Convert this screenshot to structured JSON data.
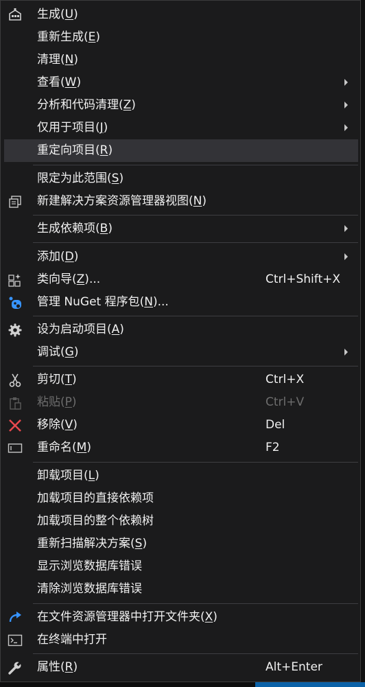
{
  "menu": {
    "build": {
      "label": "生成",
      "key": "U"
    },
    "rebuild": {
      "label": "重新生成",
      "key": "E"
    },
    "clean": {
      "label": "清理",
      "key": "N"
    },
    "view": {
      "label": "查看",
      "key": "W"
    },
    "analyze": {
      "label": "分析和代码清理",
      "key": "Z"
    },
    "project_only": {
      "label": "仅用于项目",
      "key": "J"
    },
    "retarget": {
      "label": "重定向项目",
      "key": "R"
    },
    "scope": {
      "label": "限定为此范围",
      "key": "S"
    },
    "new_view": {
      "label": "新建解决方案资源管理器视图",
      "key": "N"
    },
    "build_deps": {
      "label": "生成依赖项",
      "key": "B"
    },
    "add": {
      "label": "添加",
      "key": "D"
    },
    "class_wizard": {
      "label": "类向导",
      "key": "Z",
      "suffix": "...",
      "shortcut": "Ctrl+Shift+X"
    },
    "nuget": {
      "label": "管理 NuGet 程序包",
      "key": "N",
      "suffix": "..."
    },
    "startup": {
      "label": "设为启动项目",
      "key": "A"
    },
    "debug": {
      "label": "调试",
      "key": "G"
    },
    "cut": {
      "label": "剪切",
      "key": "T",
      "shortcut": "Ctrl+X"
    },
    "paste": {
      "label": "粘贴",
      "key": "P",
      "shortcut": "Ctrl+V"
    },
    "remove": {
      "label": "移除",
      "key": "V",
      "shortcut": "Del"
    },
    "rename": {
      "label": "重命名",
      "key": "M",
      "shortcut": "F2"
    },
    "unload": {
      "label": "卸载项目",
      "key": "L"
    },
    "load_direct": {
      "label": "加载项目的直接依赖项"
    },
    "load_tree": {
      "label": "加载项目的整个依赖树"
    },
    "rescan": {
      "label": "重新扫描解决方案",
      "key": "S"
    },
    "show_db_errors": {
      "label": "显示浏览数据库错误"
    },
    "clear_db_errors": {
      "label": "清除浏览数据库错误"
    },
    "open_folder": {
      "label": "在文件资源管理器中打开文件夹",
      "key": "X"
    },
    "open_terminal": {
      "label": "在终端中打开"
    },
    "properties": {
      "label": "属性",
      "key": "R",
      "shortcut": "Alt+Enter"
    }
  },
  "colors": {
    "background": "#1b1b1c",
    "hover": "#333337",
    "text": "#f1f1f1",
    "disabled": "#6d6d6d",
    "remove_icon": "#e8484d",
    "accent_blue": "#3794ff"
  },
  "icons": {
    "build": "build-icon",
    "new_view": "new-view-icon",
    "class_wizard": "class-wizard-icon",
    "nuget": "nuget-icon",
    "startup": "gear-icon",
    "cut": "scissors-icon",
    "paste": "clipboard-icon",
    "remove": "close-icon",
    "rename": "rename-icon",
    "open_folder": "redo-arrow-icon",
    "open_terminal": "terminal-icon",
    "properties": "wrench-icon"
  }
}
